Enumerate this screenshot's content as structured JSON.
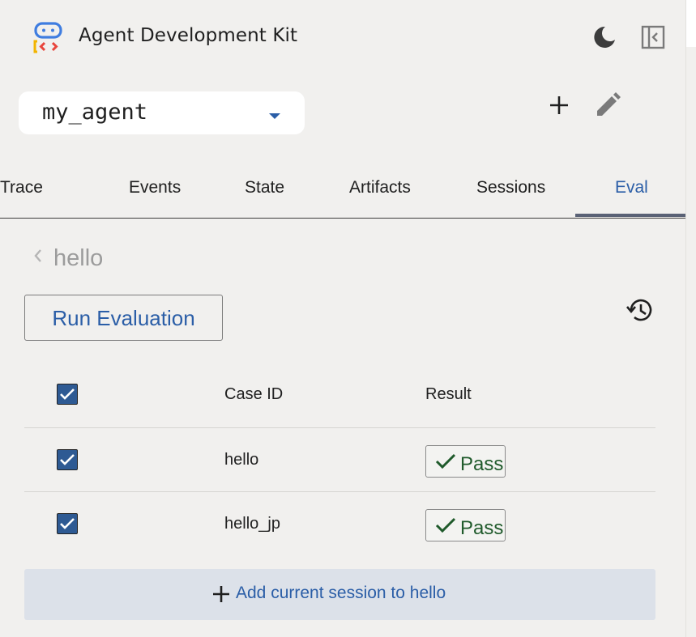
{
  "header": {
    "title": "Agent Development Kit",
    "logo_icon": "adk-logo-icon",
    "theme_icon": "dark-mode-moon-icon",
    "collapse_icon": "sidebar-collapse-icon"
  },
  "agent_selector": {
    "value": "my_agent",
    "caret_icon": "dropdown-caret-icon",
    "new_session_icon": "plus-icon",
    "edit_icon": "pencil-edit-icon"
  },
  "tabs": [
    {
      "label": "Trace",
      "active": false
    },
    {
      "label": "Events",
      "active": false
    },
    {
      "label": "State",
      "active": false
    },
    {
      "label": "Artifacts",
      "active": false
    },
    {
      "label": "Sessions",
      "active": false
    },
    {
      "label": "Eval",
      "active": true
    }
  ],
  "eval": {
    "set_name": "hello",
    "run_button": "Run Evaluation",
    "history_icon": "history-icon",
    "table": {
      "columns": [
        "Case ID",
        "Result"
      ],
      "select_all_checked": true,
      "rows": [
        {
          "checked": true,
          "case_id": "hello",
          "result": "Pass"
        },
        {
          "checked": true,
          "case_id": "hello_jp",
          "result": "Pass"
        }
      ]
    },
    "add_button": "Add current session to hello"
  },
  "colors": {
    "accent": "#2b5ea7",
    "checkbox": "#2e5a93",
    "pass_text": "#1f5a2b",
    "add_button_bg": "#dce1e9",
    "background": "#f1f0ee"
  }
}
